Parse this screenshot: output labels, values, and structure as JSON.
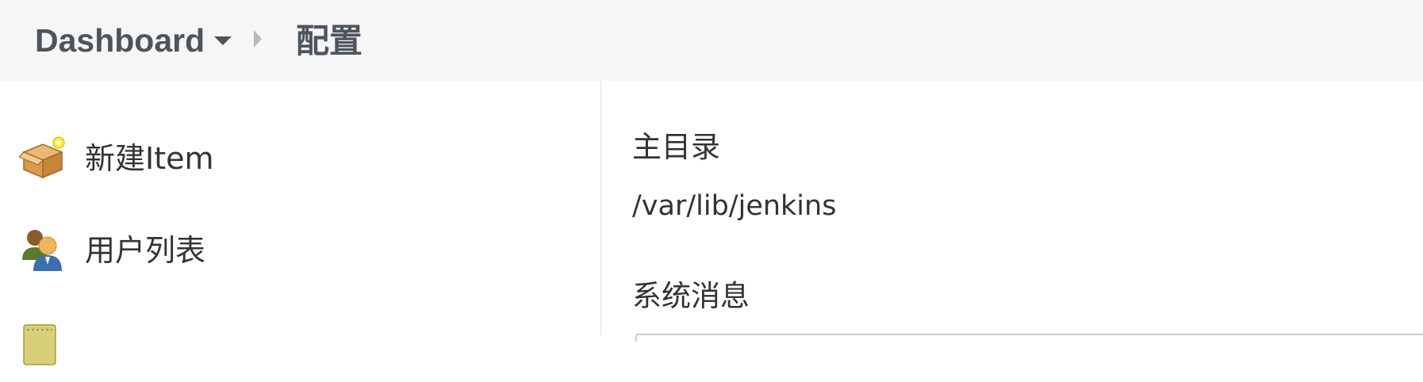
{
  "breadcrumb": {
    "root": "Dashboard",
    "current": "配置"
  },
  "sidebar": {
    "items": [
      {
        "label": "新建Item",
        "icon": "new-item-box-icon"
      },
      {
        "label": "用户列表",
        "icon": "users-icon"
      },
      {
        "label": "",
        "icon": "notepad-icon"
      }
    ]
  },
  "main": {
    "home_dir_label": "主目录",
    "home_dir_value": "/var/lib/jenkins",
    "system_message_label": "系统消息"
  }
}
